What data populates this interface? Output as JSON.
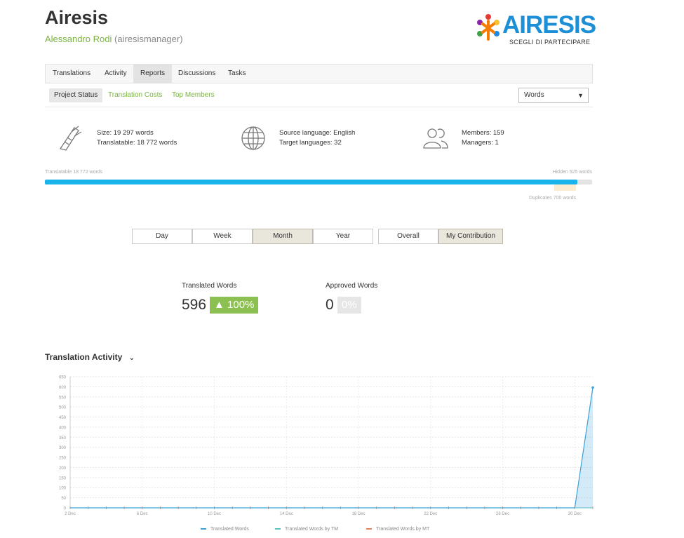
{
  "project": {
    "title": "Airesis",
    "owner_name": "Alessandro Rodi",
    "owner_username": "(airesismanager)"
  },
  "logo": {
    "text": "AIRESIS",
    "tagline": "SCEGLI DI PARTECIPARE"
  },
  "tabs": [
    {
      "label": "Translations"
    },
    {
      "label": "Activity"
    },
    {
      "label": "Reports",
      "active": true
    },
    {
      "label": "Discussions"
    },
    {
      "label": "Tasks"
    }
  ],
  "subtabs": [
    {
      "label": "Project Status",
      "active": true
    },
    {
      "label": "Translation Costs"
    },
    {
      "label": "Top Members"
    }
  ],
  "unit_select": {
    "value": "Words",
    "arrow": "▼"
  },
  "stats": {
    "size": "Size: 19 297 words",
    "translatable": "Translatable: 18 772 words",
    "source_language": "Source language: English",
    "target_languages": "Target languages: 32",
    "members": "Members: 159",
    "managers": "Managers: 1"
  },
  "progress": {
    "translatable_label": "Translatable 18 772 words",
    "hidden_label": "Hidden 525 words",
    "duplicates_label": "Duplicates 700 words",
    "translatable_fraction": 0.973
  },
  "periods": [
    {
      "label": "Day"
    },
    {
      "label": "Week"
    },
    {
      "label": "Month",
      "active": true
    },
    {
      "label": "Year"
    }
  ],
  "scopes": [
    {
      "label": "Overall"
    },
    {
      "label": "My Contribution",
      "active": true
    }
  ],
  "metrics": {
    "translated": {
      "label": "Translated Words",
      "value": "596",
      "change": "▲ 100%"
    },
    "approved": {
      "label": "Approved Words",
      "value": "0",
      "change": "0%"
    }
  },
  "activity": {
    "title": "Translation Activity",
    "chevron": "⌄"
  },
  "colors": {
    "accent_green": "#7cb342",
    "progress_blue": "#1bb3ec",
    "series_translated": "#3aa0d5",
    "series_tm": "#5cc0c4",
    "series_mt": "#e8825a"
  },
  "chart_data": {
    "type": "area",
    "title": "Translation Activity",
    "ylim": [
      0,
      650
    ],
    "yticks": [
      0,
      50,
      100,
      150,
      200,
      250,
      300,
      350,
      400,
      450,
      500,
      550,
      600,
      650
    ],
    "x_tick_labels": [
      "2 Dec",
      "6 Dec",
      "10 Dec",
      "14 Dec",
      "18 Dec",
      "22 Dec",
      "26 Dec",
      "30 Dec"
    ],
    "x_tick_days": [
      2,
      6,
      10,
      14,
      18,
      22,
      26,
      30
    ],
    "x_range": [
      2,
      31
    ],
    "grid": true,
    "legend_position": "bottom",
    "series": [
      {
        "name": "Translated Words",
        "days": [
          2,
          30,
          31
        ],
        "values": [
          0,
          0,
          596
        ]
      },
      {
        "name": "Translated Words by TM",
        "days": [
          2,
          31
        ],
        "values": [
          0,
          0
        ]
      },
      {
        "name": "Translated Words by MT",
        "days": [
          2,
          31
        ],
        "values": [
          0,
          0
        ]
      }
    ]
  }
}
